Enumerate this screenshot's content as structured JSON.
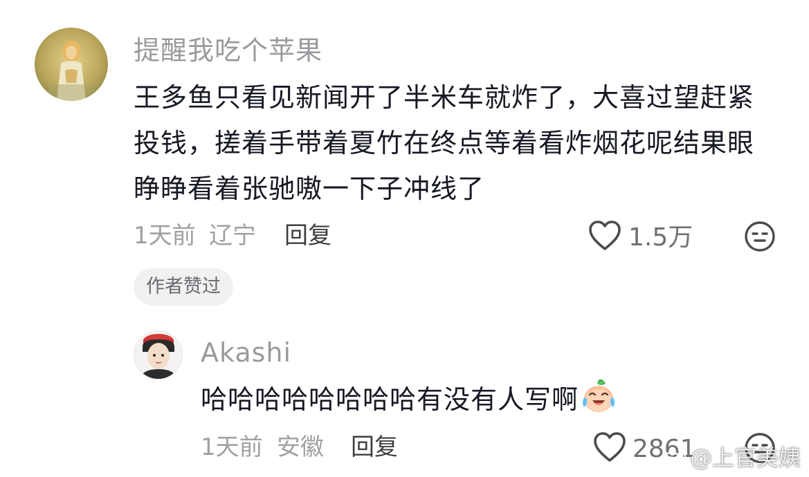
{
  "comment": {
    "username": "提醒我吃个苹果",
    "text": "王多鱼只看见新闻开了半米车就炸了，大喜过望赶紧投钱，搓着手带着夏竹在终点等着看炸烟花呢结果眼睁睁看着张驰嗷一下子冲线了",
    "time": "1天前",
    "location": "辽宁",
    "reply_label": "回复",
    "likes": "1.5万",
    "badge": "作者赞过",
    "avatar_icon": "zelda-avatar"
  },
  "reply": {
    "username": "Akashi",
    "text": "哈哈哈哈哈哈哈哈有没有人写啊",
    "emoji_icon": "crying-laughing-emoji",
    "time": "1天前",
    "location": "安徽",
    "reply_label": "回复",
    "likes": "2861",
    "avatar_icon": "boy-red-cap-avatar"
  },
  "watermark": "@上官美姨",
  "colors": {
    "primary_text": "#161823",
    "secondary_text": "#9a9a9e",
    "badge_bg": "#f1f1f2"
  }
}
